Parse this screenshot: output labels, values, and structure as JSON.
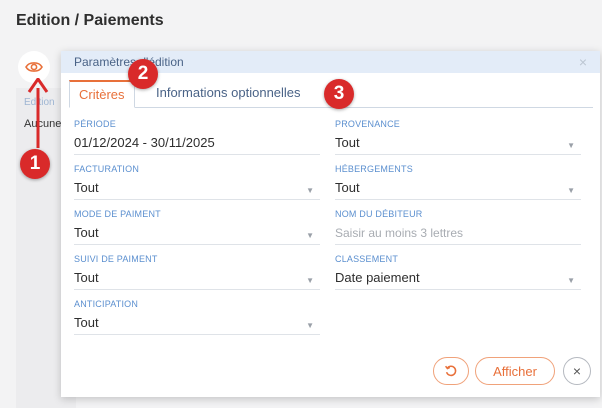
{
  "page": {
    "title": "Edition / Paiements"
  },
  "background": {
    "label": "Edition",
    "value": "Aucune"
  },
  "dialog": {
    "title": "Paramètres d'édition",
    "close_icon": "×",
    "tabs": [
      {
        "label": "Critères",
        "active": true
      },
      {
        "label": "Informations optionnelles",
        "active": false
      }
    ],
    "fields_left": [
      {
        "label": "PÉRIODE",
        "value": "01/12/2024 - 30/11/2025",
        "dropdown": false
      },
      {
        "label": "FACTURATION",
        "value": "Tout",
        "dropdown": true
      },
      {
        "label": "MODE DE PAIMENT",
        "value": "Tout",
        "dropdown": true
      },
      {
        "label": "SUIVI DE PAIMENT",
        "value": "Tout",
        "dropdown": true
      },
      {
        "label": "ANTICIPATION",
        "value": "Tout",
        "dropdown": true
      }
    ],
    "fields_right": [
      {
        "label": "PROVENANCE",
        "value": "Tout",
        "dropdown": true
      },
      {
        "label": "HÉBERGEMENTS",
        "value": "Tout",
        "dropdown": true
      },
      {
        "label": "NOM DU DÉBITEUR",
        "placeholder": "Saisir au moins 3 lettres",
        "dropdown": false
      },
      {
        "label": "CLASSEMENT",
        "value": "Date paiement",
        "dropdown": true
      }
    ],
    "footer": {
      "reset_icon": "reset-icon",
      "submit_label": "Afficher",
      "close_icon": "×"
    }
  },
  "annotations": {
    "badge1": "1",
    "badge2": "2",
    "badge3": "3"
  },
  "colors": {
    "accent": "#e8703a",
    "label": "#5b8fcf",
    "header": "#e3ecf8",
    "badge": "#d92a2a"
  },
  "caret_glyph": "▼"
}
